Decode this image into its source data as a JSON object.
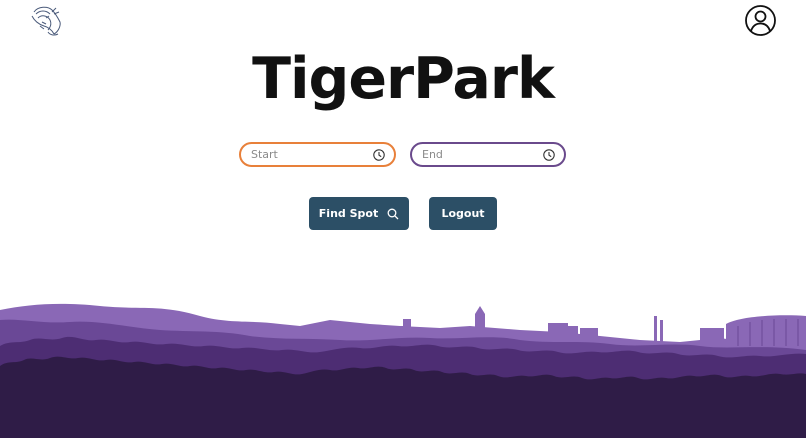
{
  "app": {
    "title": "TigerPark"
  },
  "header": {
    "logo_icon": "tiger-logo-icon",
    "profile_icon": "user-profile-icon"
  },
  "time_inputs": {
    "start": {
      "placeholder": "Start",
      "value": "",
      "icon": "clock-icon",
      "border_color": "#e8803a"
    },
    "end": {
      "placeholder": "End",
      "value": "",
      "icon": "clock-icon",
      "border_color": "#6a4a8c"
    }
  },
  "actions": {
    "find_spot_label": "Find Spot",
    "find_spot_icon": "search-icon",
    "logout_label": "Logout",
    "button_color": "#2c4f66"
  },
  "colors": {
    "skyline_light": "#8a68b6",
    "skyline_mid": "#6a4896",
    "skyline_dark": "#4d2d73",
    "skyline_darkest": "#2f1c47"
  }
}
